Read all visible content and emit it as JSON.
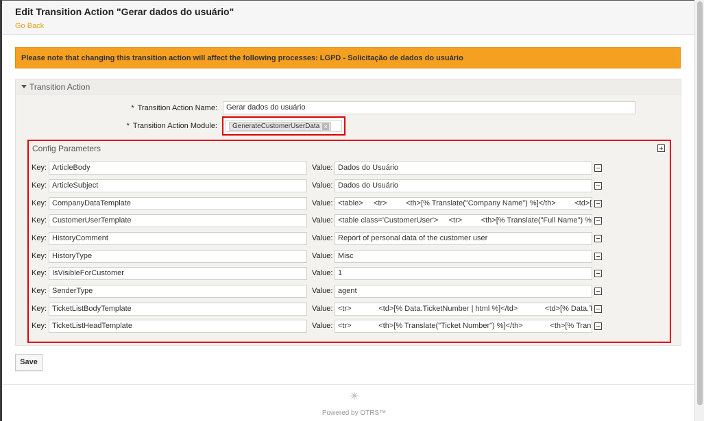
{
  "header": {
    "title": "Edit Transition Action \"Gerar dados do usuário\"",
    "go_back": "Go Back"
  },
  "notice": {
    "text": "Please note that changing this transition action will affect the following processes: LGPD - Solicitação de dados do usuário"
  },
  "transition_action": {
    "section_title": "Transition Action",
    "name_label": "Transition Action Name:",
    "name_value": "Gerar dados do usuário",
    "module_label": "Transition Action Module:",
    "module_value": "GenerateCustomerUserData",
    "required_mark": "*"
  },
  "config": {
    "title": "Config Parameters",
    "key_label": "Key:",
    "value_label": "Value:",
    "params": [
      {
        "key": "ArticleBody",
        "value": "Dados do Usuário"
      },
      {
        "key": "ArticleSubject",
        "value": "Dados do Usuário"
      },
      {
        "key": "CompanyDataTemplate",
        "value": "<table>     <tr>         <th>[% Translate(\"Company Name\") %]</th>         <td>[% Data.CompanyName %]</td>"
      },
      {
        "key": "CustomerUserTemplate",
        "value": "<table class='CustomerUser'>     <tr>         <th>[% Translate(\"Full Name\") %]</th>"
      },
      {
        "key": "HistoryComment",
        "value": "Report of personal data of the customer user"
      },
      {
        "key": "HistoryType",
        "value": "Misc"
      },
      {
        "key": "IsVisibleForCustomer",
        "value": "1"
      },
      {
        "key": "SenderType",
        "value": "agent"
      },
      {
        "key": "TicketListBodyTemplate",
        "value": "<tr>             <td>[% Data.TicketNumber | html %]</td>             <td>[% Data.Title | html %]</td>"
      },
      {
        "key": "TicketListHeadTemplate",
        "value": "<tr>             <th>[% Translate(\"Ticket Number\") %]</th>             <th>[% Translate(\"Title\") %]</th>"
      }
    ]
  },
  "actions": {
    "save": "Save"
  },
  "footer": {
    "powered_by": "Powered by OTRS™"
  },
  "colors": {
    "notice_bg": "#f5a020",
    "link": "#e8a317",
    "highlight_border": "#e00000"
  }
}
